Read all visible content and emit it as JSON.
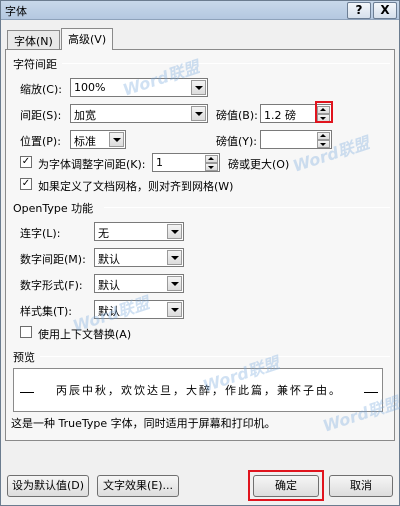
{
  "window": {
    "title": "字体",
    "help_label": "?",
    "close_label": "X"
  },
  "tabs": [
    {
      "label": "字体(N)"
    },
    {
      "label": "高级(V)"
    }
  ],
  "char_spacing": {
    "section_title": "字符间距",
    "scale_label": "缩放(C):",
    "scale_value": "100%",
    "spacing_label": "间距(S):",
    "spacing_value": "加宽",
    "spacing_by_label": "磅值(B):",
    "spacing_by_value": "1.2 磅",
    "position_label": "位置(P):",
    "position_value": "标准",
    "position_by_label": "磅值(Y):",
    "position_by_value": "",
    "kerning_label": "为字体调整字间距(K):",
    "kerning_value": "1",
    "kerning_suffix": "磅或更大(O)",
    "grid_label": "如果定义了文档网格，则对齐到网格(W)",
    "kerning_checked": "✓",
    "grid_checked": "✓"
  },
  "opentype": {
    "section_title": "OpenType 功能",
    "ligatures_label": "连字(L):",
    "ligatures_value": "无",
    "number_spacing_label": "数字间距(M):",
    "number_spacing_value": "默认",
    "number_forms_label": "数字形式(F):",
    "number_forms_value": "默认",
    "stylistic_sets_label": "样式集(T):",
    "stylistic_sets_value": "默认",
    "contextual_label": "使用上下文替换(A)",
    "contextual_checked": ""
  },
  "preview": {
    "section_title": "预览",
    "sample_text": "丙辰中秋，欢饮达旦，大醉，作此篇，兼怀子由。",
    "description": "这是一种 TrueType 字体，同时适用于屏幕和打印机。"
  },
  "buttons": {
    "set_default": "设为默认值(D)",
    "text_effects": "文字效果(E)...",
    "ok": "确定",
    "cancel": "取消"
  },
  "watermark": {
    "text": "Word联盟"
  },
  "colors": {
    "highlight": "#e0141e",
    "accent": "#7aaad8"
  }
}
